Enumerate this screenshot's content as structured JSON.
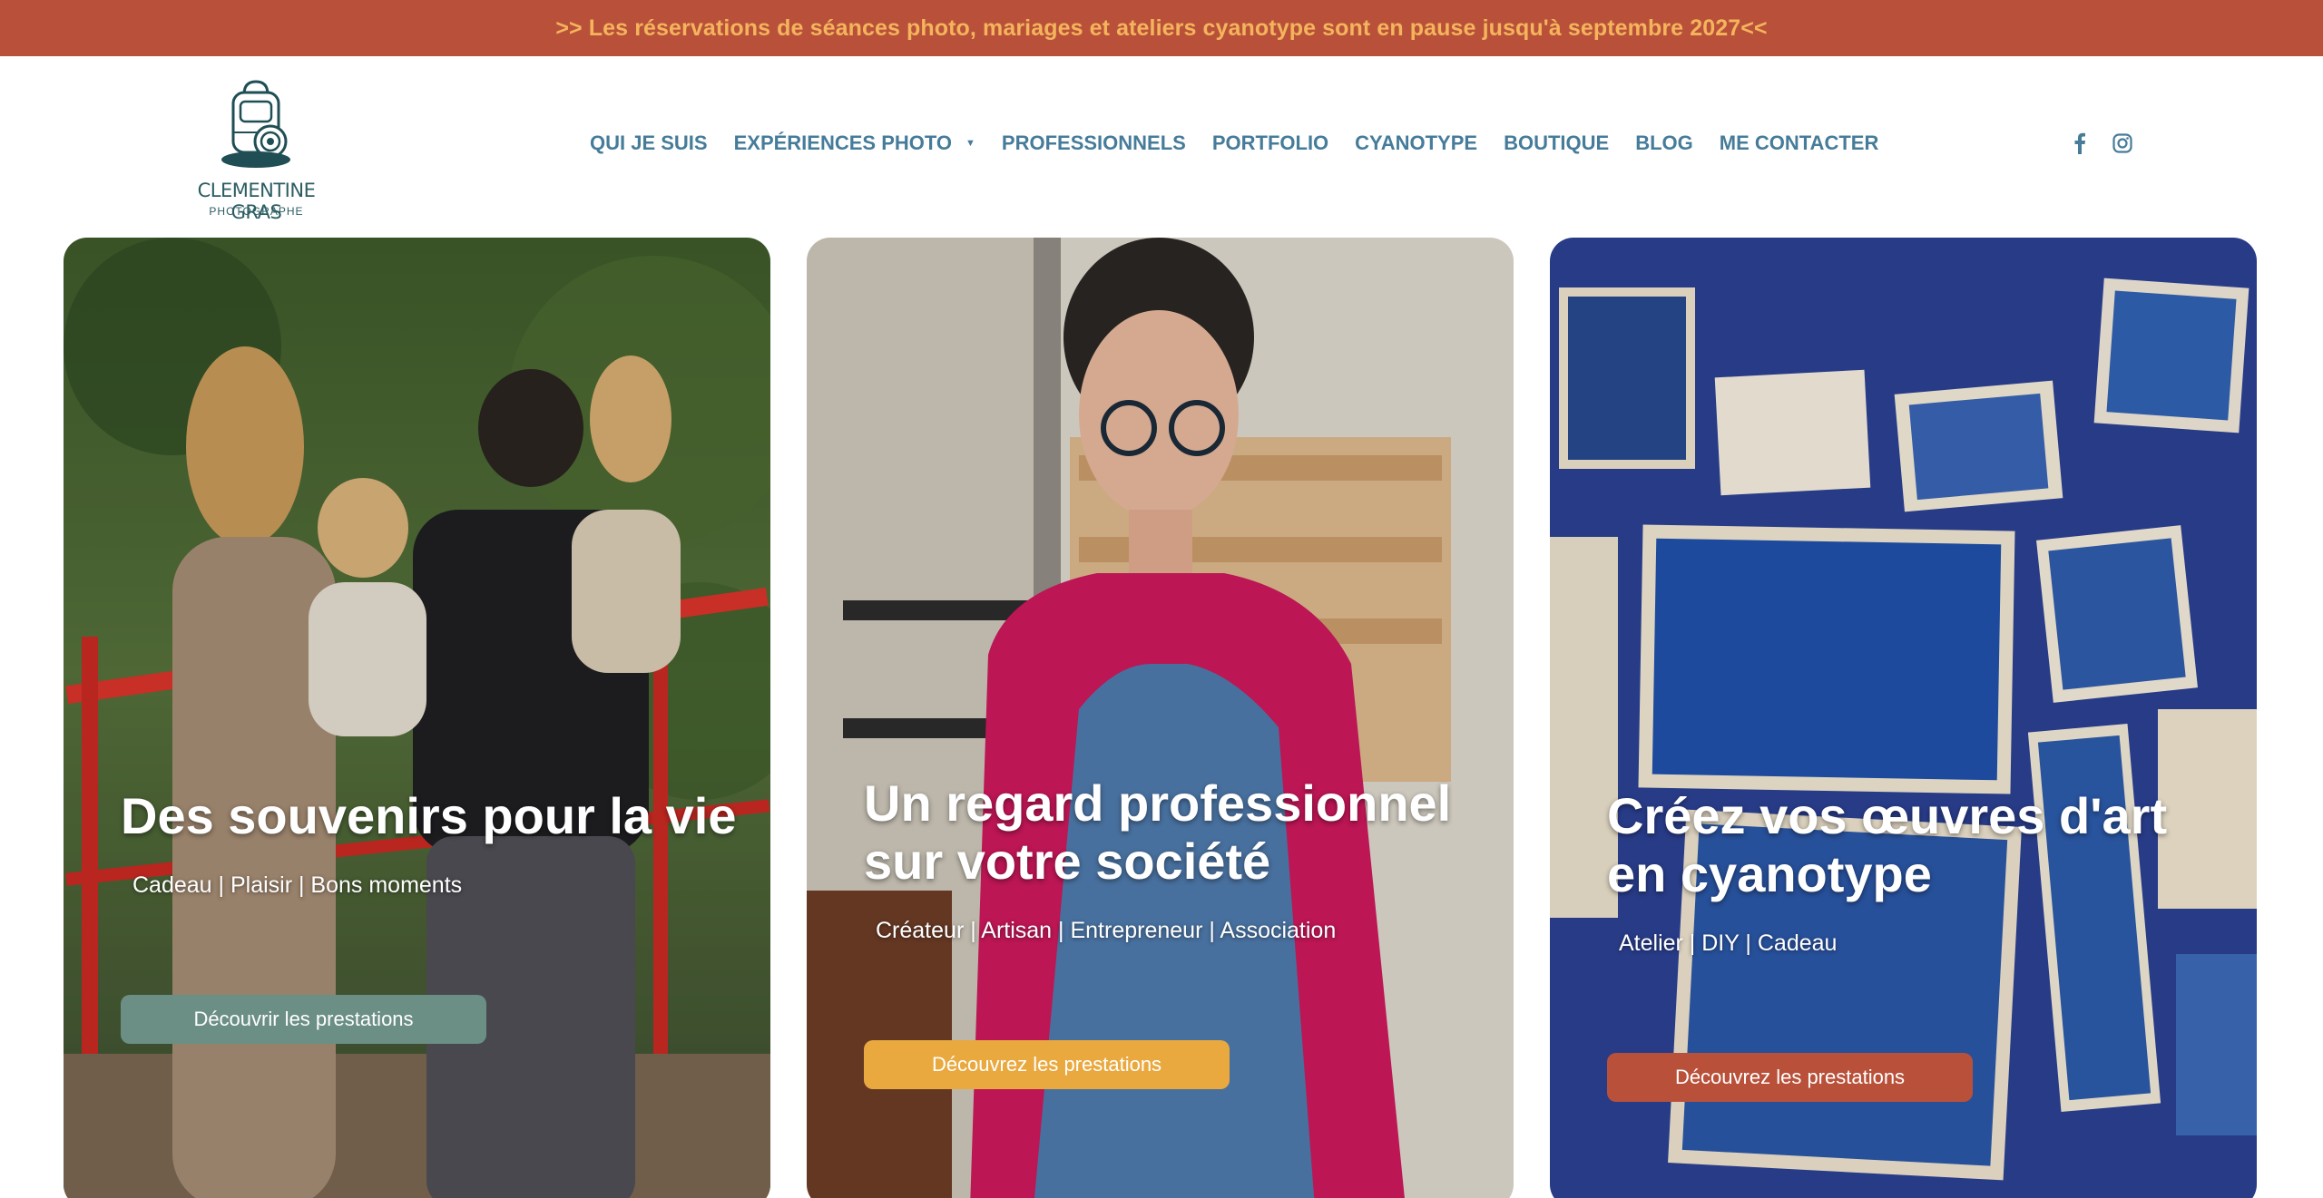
{
  "banner": {
    "text": ">> Les réservations de séances photo, mariages et ateliers cyanotype sont en pause jusqu'à septembre 2027<<"
  },
  "logo": {
    "name": "CLEMENTINE GRAS",
    "subtitle": "PHOTOGRAPHE"
  },
  "nav": {
    "items": [
      {
        "label": "QUI JE SUIS"
      },
      {
        "label": "EXPÉRIENCES PHOTO"
      },
      {
        "label": "PROFESSIONNELS"
      },
      {
        "label": "PORTFOLIO"
      },
      {
        "label": "CYANOTYPE"
      },
      {
        "label": "BOUTIQUE"
      },
      {
        "label": "BLOG"
      },
      {
        "label": "ME CONTACTER"
      }
    ]
  },
  "social": [
    {
      "icon": "facebook-icon"
    },
    {
      "icon": "instagram-icon"
    }
  ],
  "cards": [
    {
      "title": "Des souvenirs pour la vie",
      "subtitle": "Cadeau | Plaisir | Bons moments",
      "button": "Découvrir les prestations",
      "button_color": "#6b8f84"
    },
    {
      "title": "Un regard professionnel\nsur votre société",
      "subtitle": "Créateur | Artisan | Entrepreneur | Association",
      "button": "Découvrez les prestations",
      "button_color": "#e9a93f"
    },
    {
      "title": "Créez vos œuvres d'art\nen cyanotype",
      "subtitle": "Atelier | DIY | Cadeau",
      "button": "Découvrez les prestations",
      "button_color": "#b9513a"
    }
  ],
  "colors": {
    "banner_bg": "#b9513a",
    "banner_text": "#f4b45c",
    "nav_text": "#467c9a",
    "logo": "#2c5d63"
  }
}
